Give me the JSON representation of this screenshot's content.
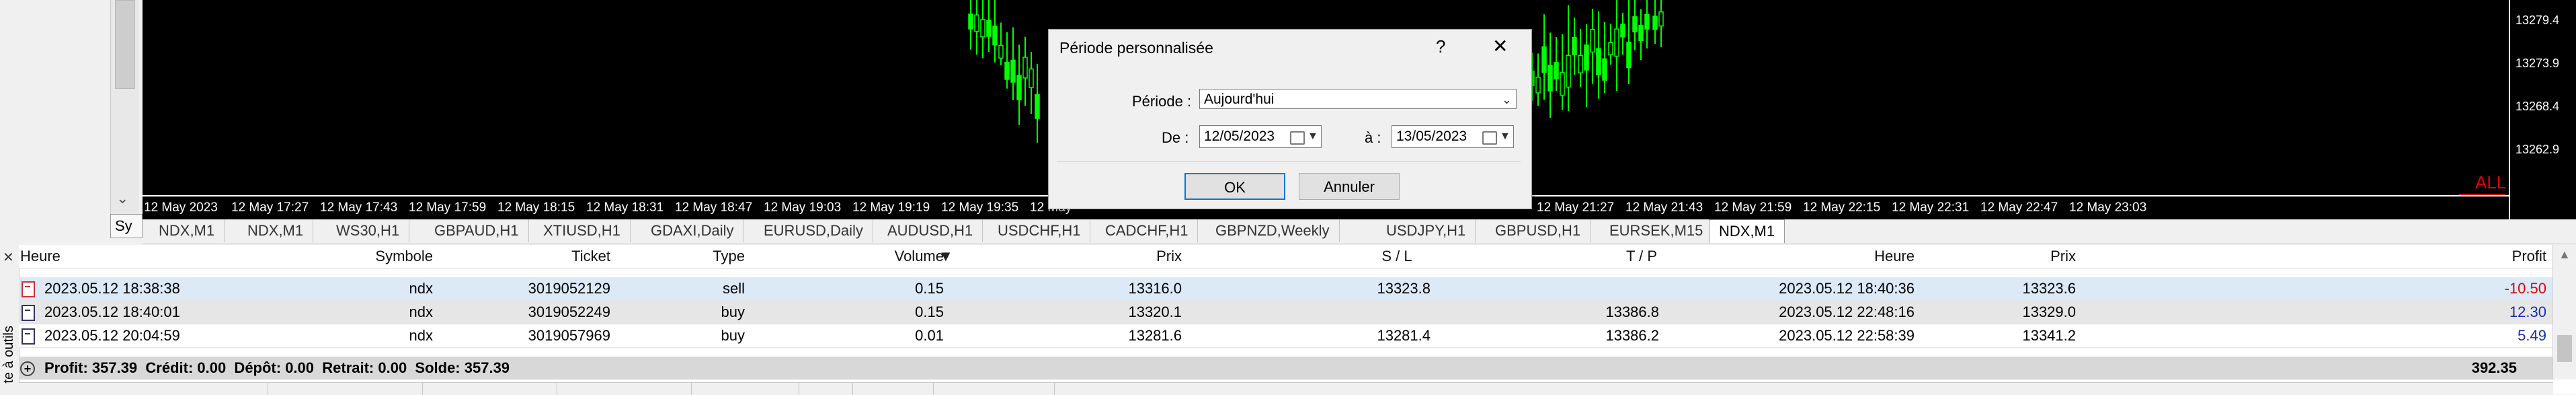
{
  "chart": {
    "price_labels": [
      "13279.4",
      "13273.9",
      "13268.4",
      "13262.9"
    ],
    "time_labels": [
      "12 May 2023",
      "12 May 17:27",
      "12 May 17:43",
      "12 May 17:59",
      "12 May 18:15",
      "12 May 18:31",
      "12 May 18:47",
      "12 May 19:03",
      "12 May 19:19",
      "12 May 19:35",
      "12 May",
      "12 May 21:27",
      "12 May 21:43",
      "12 May 21:59",
      "12 May 22:15",
      "12 May 22:31",
      "12 May 22:47",
      "12 May 23:03"
    ],
    "all_label": "ALL",
    "candle_color": "#00ff00",
    "background": "#000000"
  },
  "left_panel": {
    "tab_label": "Sy"
  },
  "symbol_tabs": [
    "NDX,M1",
    "NDX,M1",
    "WS30,H1",
    "GBPAUD,H1",
    "XTIUSD,H1",
    "GDAXI,Daily",
    "EURUSD,Daily",
    "AUDUSD,H1",
    "USDCHF,H1",
    "CADCHF,H1",
    "GBPNZD,Weekly",
    "USDJPY,H1",
    "GBPUSD,H1",
    "EURSEK,M15",
    "NDX,M1"
  ],
  "active_tab_index": 14,
  "dialog": {
    "title": "Période personnalisée",
    "help": "?",
    "close": "✕",
    "period_label": "Période :",
    "period_value": "Aujourd'hui",
    "from_label": "De :",
    "from_value": "12/05/2023",
    "to_label": "à :",
    "to_value": "13/05/2023",
    "ok_label": "OK",
    "cancel_label": "Annuler"
  },
  "terminal": {
    "side_label": "te à outils",
    "headers": {
      "heure": "Heure",
      "symbole": "Symbole",
      "ticket": "Ticket",
      "type": "Type",
      "volume": "Volume",
      "prix": "Prix",
      "sl": "S / L",
      "tp": "T / P",
      "heure2": "Heure",
      "prix2": "Prix",
      "profit": "Profit"
    },
    "sort_indicator": "▼",
    "rows": [
      {
        "open_time": "2023.05.12 18:38:38",
        "symbol": "ndx",
        "ticket": "3019052129",
        "type": "sell",
        "volume": "0.15",
        "price": "13316.0",
        "sl": "13323.8",
        "tp": "",
        "close_time": "2023.05.12 18:40:36",
        "close_price": "13323.6",
        "profit": "-10.50"
      },
      {
        "open_time": "2023.05.12 18:40:01",
        "symbol": "ndx",
        "ticket": "3019052249",
        "type": "buy",
        "volume": "0.15",
        "price": "13320.1",
        "sl": "",
        "tp": "13386.8",
        "close_time": "2023.05.12 22:48:16",
        "close_price": "13329.0",
        "profit": "12.30"
      },
      {
        "open_time": "2023.05.12 20:04:59",
        "symbol": "ndx",
        "ticket": "3019057969",
        "type": "buy",
        "volume": "0.01",
        "price": "13281.6",
        "sl": "13281.4",
        "tp": "13386.2",
        "close_time": "2023.05.12 22:58:39",
        "close_price": "13341.2",
        "profit": "5.49"
      }
    ],
    "summary": {
      "text": "Profit: 357.39  Crédit: 0.00  Dépôt: 0.00  Retrait: 0.00  Solde: 357.39",
      "total": "392.35"
    },
    "colors": {
      "negative": "#e00000",
      "positive": "#1a2cb0",
      "selected_row": "#dce9f7"
    }
  }
}
